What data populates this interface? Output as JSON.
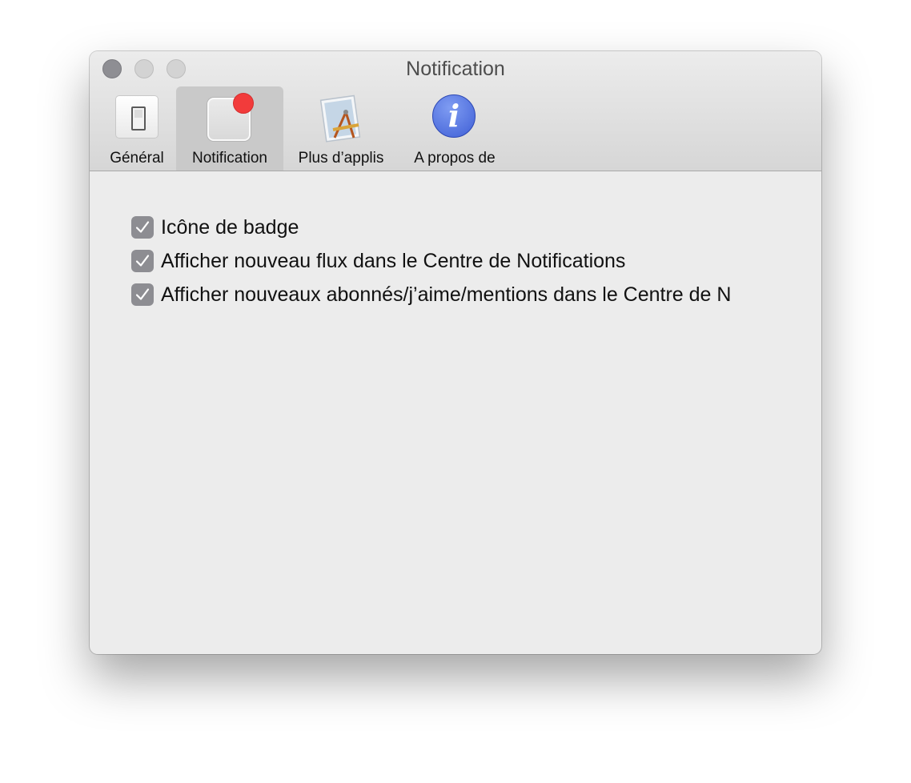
{
  "window": {
    "title": "Notification"
  },
  "toolbar": {
    "items": [
      {
        "label": "Général",
        "icon": "switch-icon",
        "selected": false
      },
      {
        "label": "Notification",
        "icon": "notification-badge-icon",
        "selected": true
      },
      {
        "label": "Plus d’applis",
        "icon": "app-store-icon",
        "selected": false
      },
      {
        "label": "A propos de",
        "icon": "info-icon",
        "selected": false
      }
    ]
  },
  "settings": {
    "checkboxes": [
      {
        "label": "Icône de badge",
        "checked": true
      },
      {
        "label": "Afficher nouveau flux dans le Centre de Notifications",
        "checked": true
      },
      {
        "label": "Afficher nouveaux abonnés/j’aime/mentions dans le Centre de N",
        "checked": true
      }
    ]
  },
  "colors": {
    "badge": "#f23b3b",
    "info_blue": "#3f5fd6",
    "checkbox": "#8d8d92"
  }
}
